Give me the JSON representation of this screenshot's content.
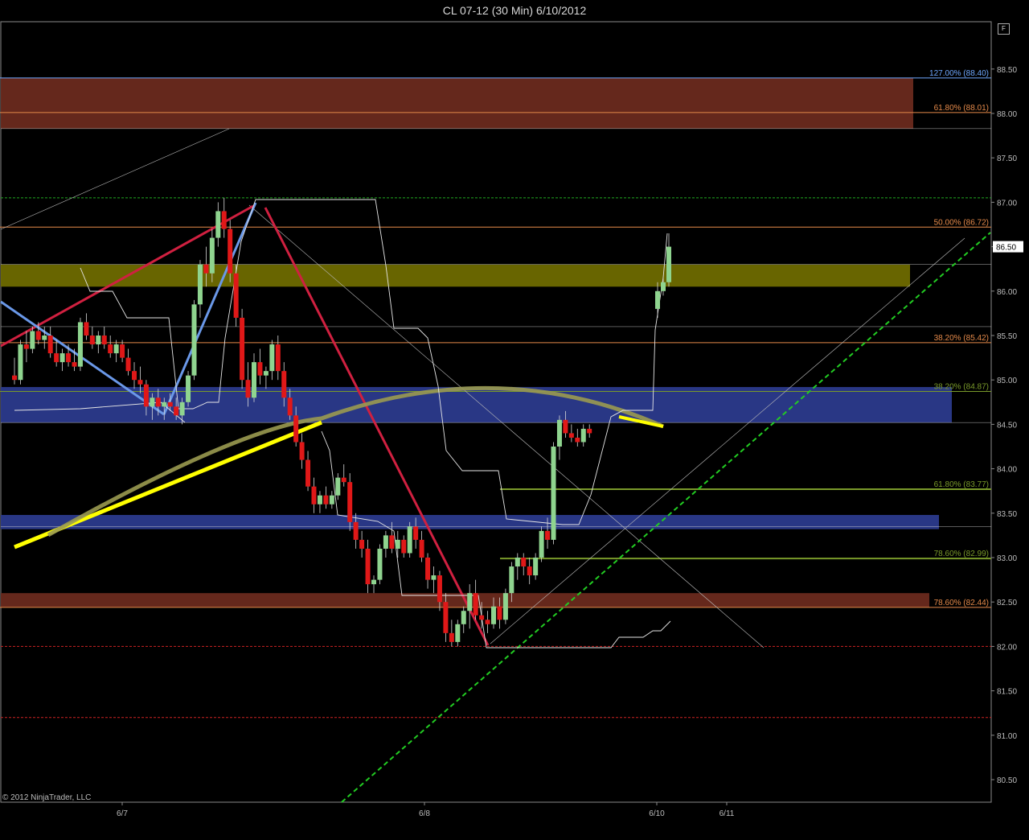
{
  "window": {
    "title": "CL 07-12 (30 Min)  6/10/2012"
  },
  "footer": {
    "copyright": "© 2012 NinjaTrader, LLC"
  },
  "toolbar": {
    "f_button_label": "F",
    "play_icon": "skip-forward-icon"
  },
  "colors": {
    "background": "#000000",
    "up_candle": "#8fd48f",
    "down_candle": "#e01818",
    "supply_zone": "#6a2a1e",
    "demand_zone": "#2b3a8c",
    "yellow_zone": "#6e6a00",
    "fib_orange": "#e58a4a",
    "fib_green": "#7a9a2a",
    "fib_blue": "#6fa8ff",
    "trend_green": "#22cc22",
    "yellow_line": "#ffff00",
    "red_swing": "#d02040",
    "blue_swing": "#6a98e8",
    "arc": "#9a9a50"
  },
  "chart_data": {
    "type": "candlestick",
    "title": "CL 07-12 (30 Min)  6/10/2012",
    "ylim": [
      80.3,
      89.0
    ],
    "y_ticks": [
      80.5,
      81.0,
      81.5,
      82.0,
      82.5,
      83.0,
      83.5,
      84.0,
      84.5,
      85.0,
      85.5,
      86.0,
      86.5,
      87.0,
      87.5,
      88.0,
      88.5
    ],
    "y_tick_labels": [
      "80.50",
      "81.00",
      "81.50",
      "82.00",
      "82.50",
      "83.00",
      "83.50",
      "84.00",
      "84.50",
      "85.00",
      "85.50",
      "86.00",
      "86.50",
      "87.00",
      "87.50",
      "88.00",
      "88.50"
    ],
    "x_labels": [
      {
        "label": "6/7",
        "bar": 15
      },
      {
        "label": "6/8",
        "bar": 64
      },
      {
        "label": "6/10",
        "bar": 99
      },
      {
        "label": "6/11",
        "bar": 111
      }
    ],
    "bar_count": 162,
    "last_price": {
      "value": 86.5,
      "label": "86.50"
    },
    "candles": [
      [
        85.05,
        85.25,
        84.95,
        85.0
      ],
      [
        85.0,
        85.45,
        84.95,
        85.4
      ],
      [
        85.4,
        85.55,
        85.2,
        85.35
      ],
      [
        85.35,
        85.6,
        85.3,
        85.55
      ],
      [
        85.55,
        85.65,
        85.4,
        85.45
      ],
      [
        85.45,
        85.6,
        85.35,
        85.5
      ],
      [
        85.5,
        85.6,
        85.25,
        85.3
      ],
      [
        85.3,
        85.45,
        85.15,
        85.2
      ],
      [
        85.2,
        85.35,
        85.1,
        85.3
      ],
      [
        85.3,
        85.4,
        85.15,
        85.2
      ],
      [
        85.2,
        85.35,
        85.1,
        85.15
      ],
      [
        85.15,
        85.7,
        85.1,
        85.65
      ],
      [
        85.65,
        85.75,
        85.45,
        85.5
      ],
      [
        85.5,
        85.6,
        85.35,
        85.4
      ],
      [
        85.4,
        85.55,
        85.3,
        85.5
      ],
      [
        85.5,
        85.6,
        85.35,
        85.4
      ],
      [
        85.4,
        85.5,
        85.25,
        85.3
      ],
      [
        85.3,
        85.45,
        85.2,
        85.4
      ],
      [
        85.4,
        85.45,
        85.2,
        85.25
      ],
      [
        85.25,
        85.35,
        85.05,
        85.1
      ],
      [
        85.1,
        85.2,
        84.9,
        85.0
      ],
      [
        85.0,
        85.15,
        84.85,
        84.95
      ],
      [
        84.95,
        85.0,
        84.6,
        84.7
      ],
      [
        84.7,
        84.85,
        84.55,
        84.8
      ],
      [
        84.8,
        84.9,
        84.6,
        84.7
      ],
      [
        84.7,
        84.8,
        84.55,
        84.75
      ],
      [
        84.75,
        84.85,
        84.65,
        84.7
      ],
      [
        84.7,
        84.8,
        84.55,
        84.6
      ],
      [
        84.6,
        84.8,
        84.5,
        84.75
      ],
      [
        84.75,
        85.1,
        84.7,
        85.05
      ],
      [
        85.05,
        85.9,
        85.0,
        85.85
      ],
      [
        85.85,
        86.35,
        85.7,
        86.3
      ],
      [
        86.3,
        86.5,
        86.05,
        86.2
      ],
      [
        86.2,
        86.7,
        86.1,
        86.6
      ],
      [
        86.6,
        87.0,
        86.5,
        86.9
      ],
      [
        86.9,
        87.05,
        86.6,
        86.7
      ],
      [
        86.7,
        86.8,
        86.1,
        86.2
      ],
      [
        86.2,
        86.3,
        85.6,
        85.7
      ],
      [
        85.7,
        85.8,
        84.9,
        85.0
      ],
      [
        85.0,
        85.2,
        84.7,
        84.8
      ],
      [
        84.8,
        85.3,
        84.75,
        85.2
      ],
      [
        85.2,
        85.35,
        84.95,
        85.05
      ],
      [
        85.05,
        85.15,
        84.9,
        85.1
      ],
      [
        85.1,
        85.45,
        85.0,
        85.4
      ],
      [
        85.4,
        85.5,
        85.0,
        85.1
      ],
      [
        85.1,
        85.2,
        84.7,
        84.8
      ],
      [
        84.8,
        84.9,
        84.55,
        84.6
      ],
      [
        84.6,
        84.7,
        84.25,
        84.3
      ],
      [
        84.3,
        84.4,
        84.0,
        84.1
      ],
      [
        84.1,
        84.2,
        83.75,
        83.8
      ],
      [
        83.8,
        83.9,
        83.5,
        83.6
      ],
      [
        83.6,
        83.75,
        83.5,
        83.7
      ],
      [
        83.7,
        83.8,
        83.55,
        83.6
      ],
      [
        83.6,
        83.75,
        83.55,
        83.7
      ],
      [
        83.7,
        83.95,
        83.65,
        83.9
      ],
      [
        83.9,
        84.05,
        83.8,
        83.85
      ],
      [
        83.85,
        83.95,
        83.3,
        83.4
      ],
      [
        83.4,
        83.5,
        83.1,
        83.2
      ],
      [
        83.2,
        83.3,
        83.0,
        83.1
      ],
      [
        83.1,
        83.2,
        82.6,
        82.7
      ],
      [
        82.7,
        82.8,
        82.6,
        82.75
      ],
      [
        82.75,
        83.15,
        82.7,
        83.1
      ],
      [
        83.1,
        83.3,
        83.0,
        83.25
      ],
      [
        83.25,
        83.4,
        83.05,
        83.1
      ],
      [
        83.1,
        83.3,
        83.0,
        83.2
      ],
      [
        83.2,
        83.25,
        83.0,
        83.05
      ],
      [
        83.05,
        83.4,
        83.0,
        83.35
      ],
      [
        83.35,
        83.45,
        83.1,
        83.2
      ],
      [
        83.2,
        83.3,
        82.95,
        83.0
      ],
      [
        83.0,
        83.05,
        82.65,
        82.75
      ],
      [
        82.75,
        82.9,
        82.6,
        82.8
      ],
      [
        82.8,
        82.85,
        82.4,
        82.5
      ],
      [
        82.5,
        82.6,
        82.05,
        82.15
      ],
      [
        82.15,
        82.3,
        82.0,
        82.05
      ],
      [
        82.05,
        82.3,
        82.0,
        82.25
      ],
      [
        82.25,
        82.45,
        82.15,
        82.4
      ],
      [
        82.4,
        82.7,
        82.2,
        82.6
      ],
      [
        82.6,
        82.75,
        82.3,
        82.35
      ],
      [
        82.35,
        82.5,
        82.2,
        82.3
      ],
      [
        82.3,
        82.4,
        82.15,
        82.25
      ],
      [
        82.25,
        82.55,
        82.2,
        82.45
      ],
      [
        82.45,
        82.55,
        82.2,
        82.3
      ],
      [
        82.3,
        82.65,
        82.25,
        82.6
      ],
      [
        82.6,
        82.95,
        82.5,
        82.9
      ],
      [
        82.9,
        83.05,
        82.75,
        83.0
      ],
      [
        83.0,
        83.05,
        82.8,
        82.9
      ],
      [
        82.9,
        83.0,
        82.7,
        82.8
      ],
      [
        82.8,
        83.05,
        82.75,
        83.0
      ],
      [
        83.0,
        83.35,
        82.95,
        83.3
      ],
      [
        83.3,
        83.45,
        83.1,
        83.2
      ],
      [
        83.2,
        84.3,
        83.15,
        84.25
      ],
      [
        84.25,
        84.6,
        84.1,
        84.55
      ],
      [
        84.55,
        84.65,
        84.35,
        84.4
      ],
      [
        84.4,
        84.5,
        84.3,
        84.35
      ],
      [
        84.35,
        84.45,
        84.25,
        84.3
      ],
      [
        84.3,
        84.5,
        84.25,
        84.45
      ],
      [
        84.45,
        84.5,
        84.35,
        84.4
      ],
      [
        85.8,
        86.1,
        85.7,
        86.0
      ],
      [
        86.0,
        86.15,
        85.95,
        86.1
      ],
      [
        86.1,
        86.65,
        86.05,
        86.5
      ]
    ],
    "zones": [
      {
        "name": "supply-zone-top",
        "y0": 87.83,
        "y1": 88.4,
        "x1": 1136,
        "color": "#6a2a1e"
      },
      {
        "name": "yellow-zone",
        "y0": 86.05,
        "y1": 86.3,
        "x1": 1132,
        "color": "#6e6a00"
      },
      {
        "name": "demand-zone-upper",
        "y0": 84.52,
        "y1": 84.92,
        "x1": 1184,
        "color": "#2b3a8c"
      },
      {
        "name": "demand-zone-lower",
        "y0": 83.32,
        "y1": 83.48,
        "x1": 1168,
        "color": "#2b3a8c"
      },
      {
        "name": "supply-zone-lower",
        "y0": 82.44,
        "y1": 82.6,
        "x1": 1156,
        "color": "#6a2a1e"
      }
    ],
    "levels": [
      {
        "label": "127.00% (88.40)",
        "value": 88.4,
        "color": "#6fa8ff",
        "style": "solid",
        "x0": 0
      },
      {
        "label": "61.80% (88.01)",
        "value": 88.01,
        "color": "#e58a4a",
        "style": "solid",
        "x0": 0
      },
      {
        "label": "50.00% (86.72)",
        "value": 86.72,
        "color": "#e58a4a",
        "style": "solid",
        "x0": 0
      },
      {
        "label": "38.20% (85.42)",
        "value": 85.42,
        "color": "#e58a4a",
        "style": "solid",
        "x0": 0
      },
      {
        "label": "38.20% (84.87)",
        "value": 84.87,
        "color": "#7a9a2a",
        "style": "solid",
        "x0": 0
      },
      {
        "label": "61.80% (83.77)",
        "value": 83.77,
        "color": "#7a9a2a",
        "style": "solid",
        "x0": 622
      },
      {
        "label": "78.60% (82.99)",
        "value": 82.99,
        "color": "#7a9a2a",
        "style": "solid",
        "x0": 622
      },
      {
        "label": "78.60% (82.44)",
        "value": 82.44,
        "color": "#e58a4a",
        "style": "solid",
        "x0": 0
      }
    ],
    "dashed_levels": [
      {
        "value": 87.05,
        "color": "#22aa22"
      },
      {
        "value": 82.0,
        "color": "#cc2222"
      },
      {
        "value": 81.2,
        "color": "#cc2222"
      }
    ]
  }
}
